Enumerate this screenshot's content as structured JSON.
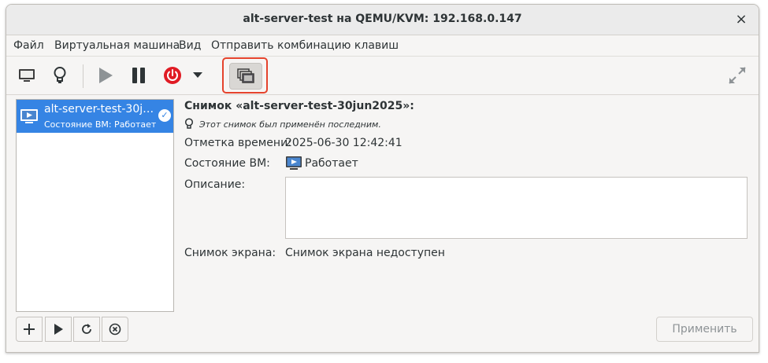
{
  "window": {
    "title": "alt-server-test на QEMU/KVM: 192.168.0.147",
    "close": "×"
  },
  "menubar": {
    "items": [
      "Файл",
      "Виртуальная машина",
      "Вид",
      "Отправить комбинацию клавиш"
    ]
  },
  "toolbar": {
    "buttons": [
      "monitor-icon",
      "lightbulb-icon",
      "play-icon",
      "pause-icon",
      "power-icon",
      "dropdown-arrow-icon",
      "snapshots-icon",
      "fullscreen-icon"
    ],
    "power_color": "#e01b24",
    "highlight_color": "#e5432d"
  },
  "snapshot_list": {
    "items": [
      {
        "name": "alt-server-test-30j…",
        "state": "Состояние ВМ: Работает",
        "selected": true
      }
    ],
    "selection_color": "#3584e4"
  },
  "list_buttons": [
    "add-icon",
    "play-icon",
    "refresh-icon",
    "delete-icon"
  ],
  "details": {
    "title": "Снимок «alt-server-test-30jun2025»:",
    "note": "Этот снимок был применён последним.",
    "timestamp_label": "Отметка времени:",
    "timestamp_value": "2025-06-30 12:42:41",
    "state_label": "Состояние ВМ:",
    "state_value": "Работает",
    "description_label": "Описание:",
    "description_value": "",
    "screenshot_label": "Снимок экрана:",
    "screenshot_value": "Снимок экрана недоступен"
  },
  "apply_button": "Применить"
}
